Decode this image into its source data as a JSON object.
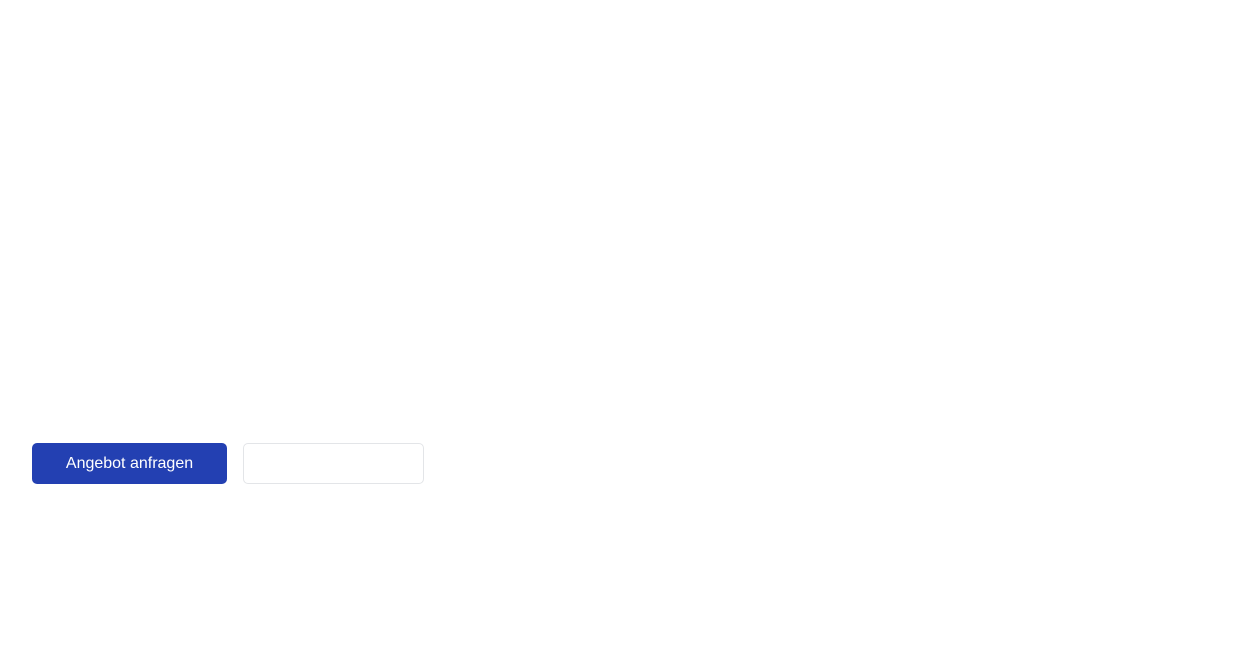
{
  "actions": {
    "primary_label": "Angebot anfragen",
    "secondary_label": ""
  },
  "colors": {
    "primary": "#2340b2",
    "secondary_border": "#e3e5e8",
    "background": "#ffffff"
  }
}
